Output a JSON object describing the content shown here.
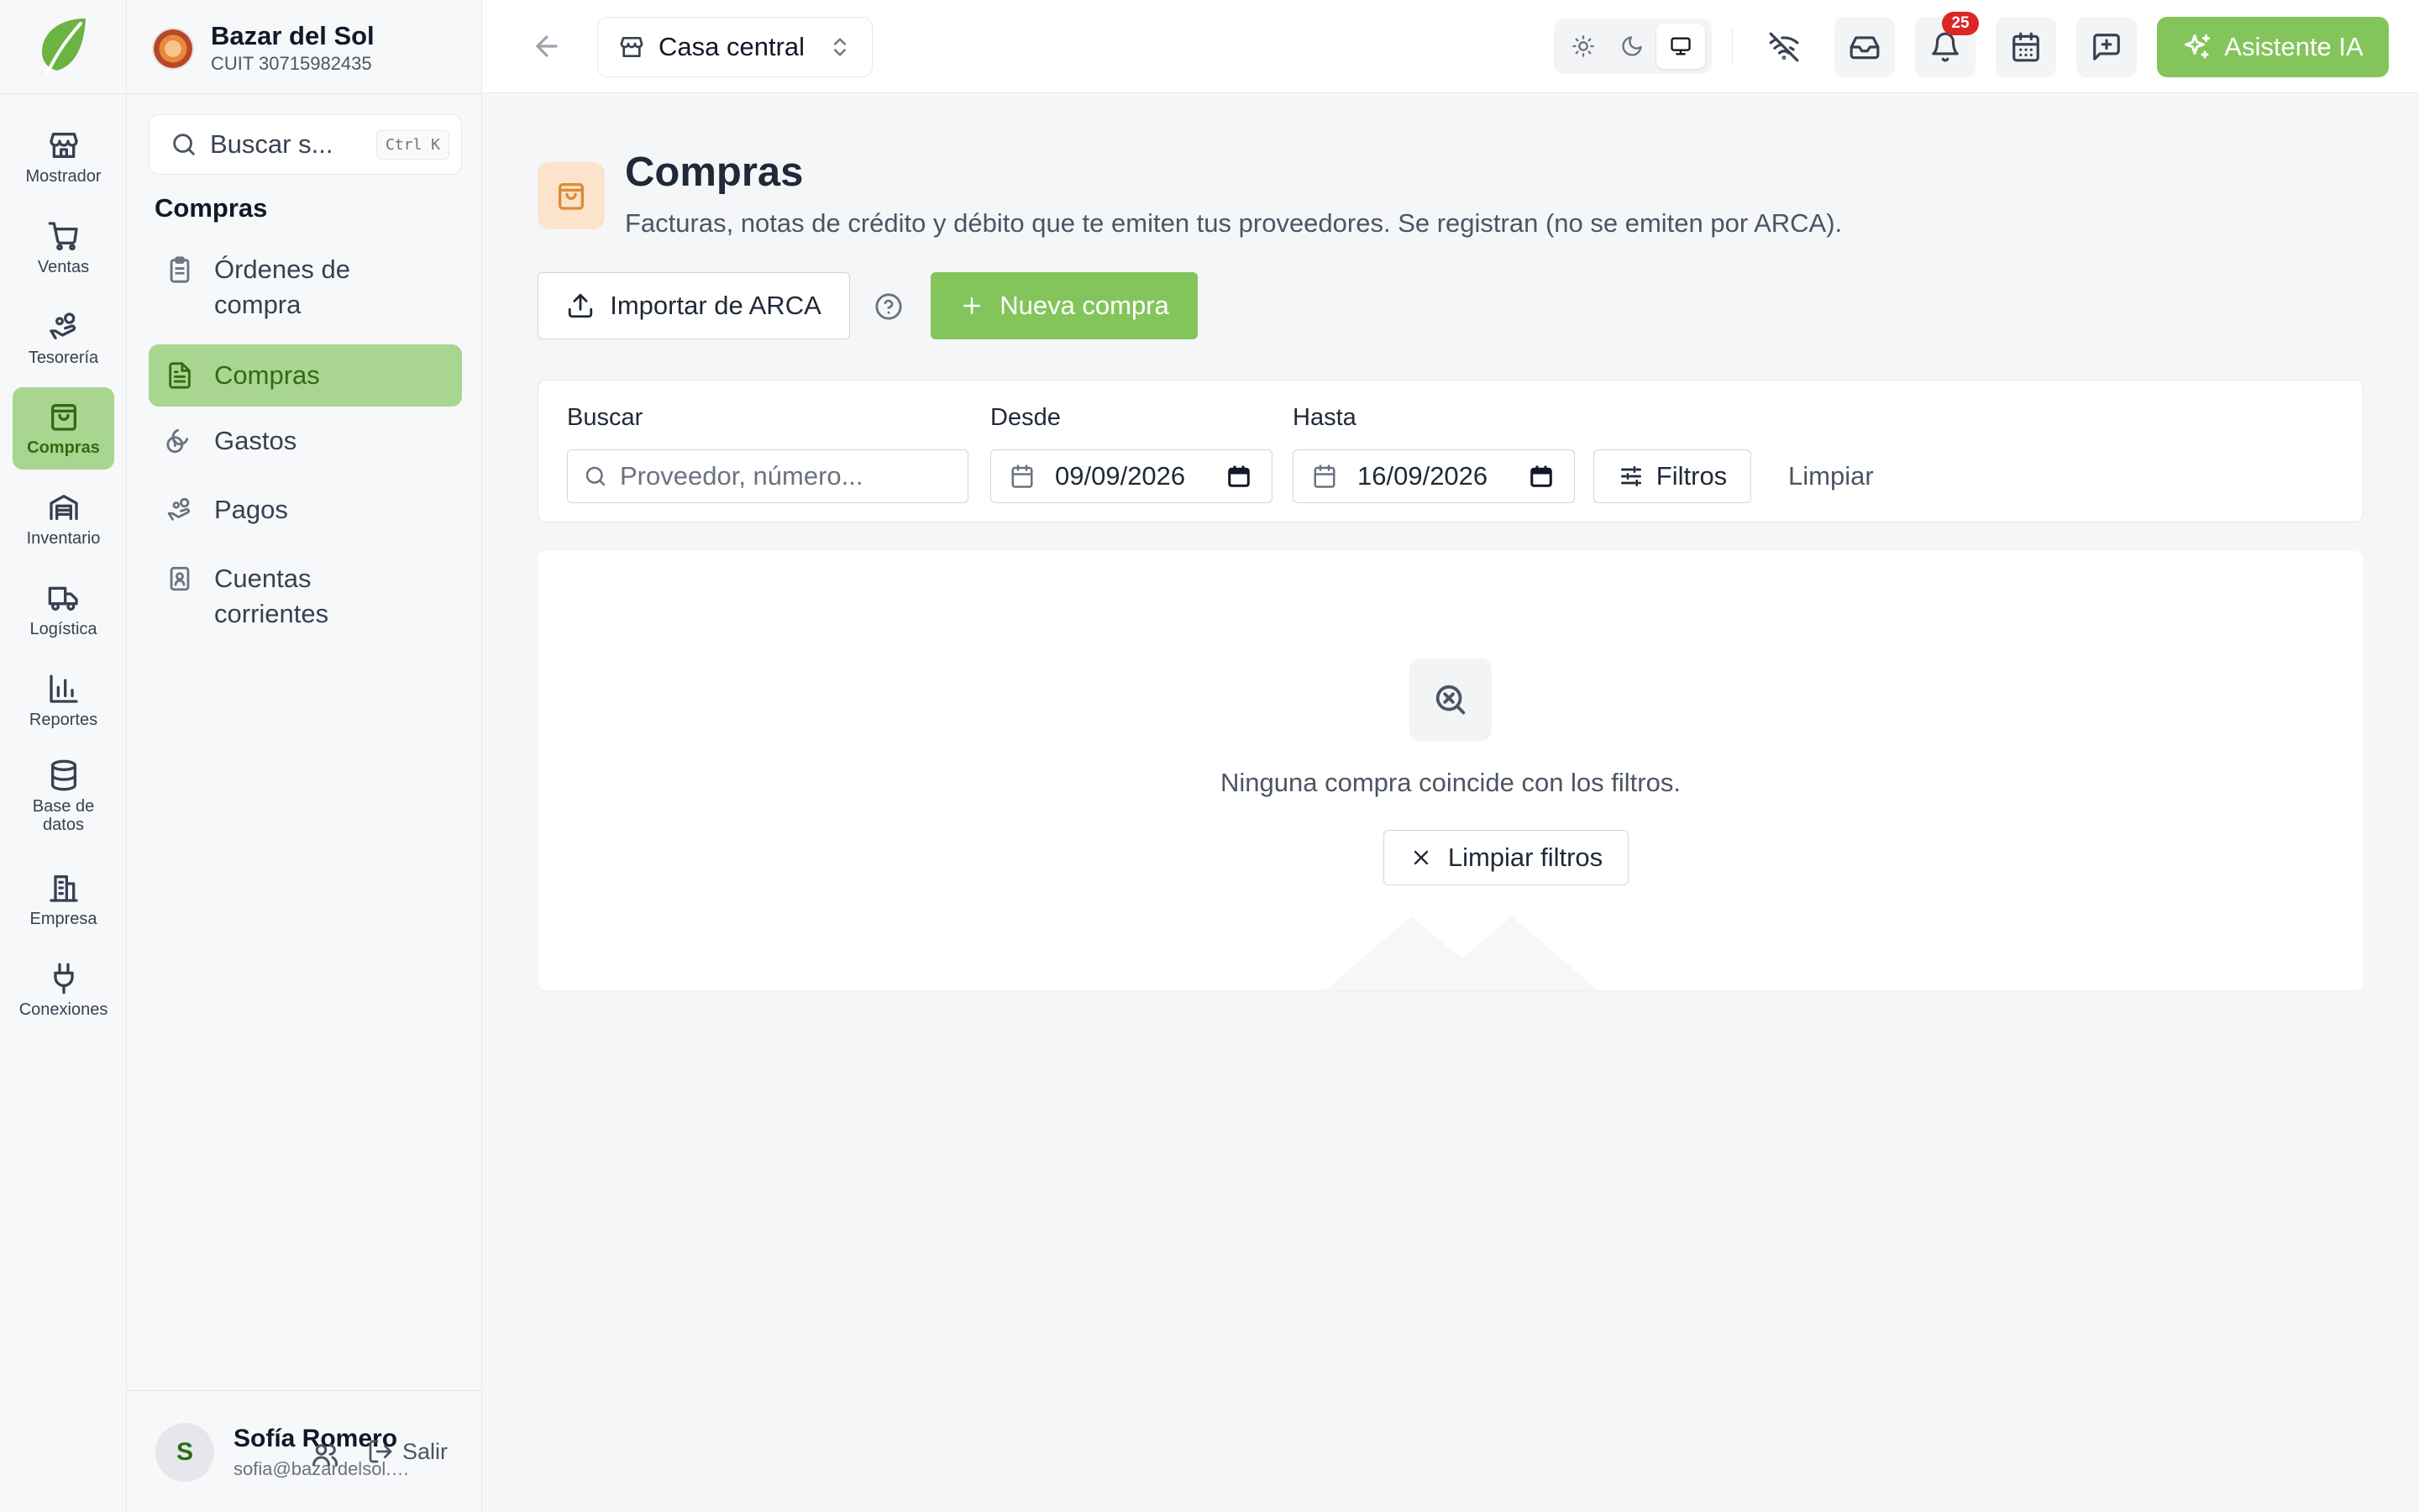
{
  "colors": {
    "accent": "#84c55b",
    "active_bg": "#a8d58f",
    "active_text": "#2f6b12",
    "badge": "#dc2626",
    "header_icon_bg": "#fbe3cc",
    "header_icon": "#e08a35"
  },
  "rail": {
    "items": [
      {
        "label": "Mostrador",
        "icon": "store-icon"
      },
      {
        "label": "Ventas",
        "icon": "cart-icon"
      },
      {
        "label": "Tesorería",
        "icon": "hand-coins-icon"
      },
      {
        "label": "Compras",
        "icon": "shopping-bag-icon",
        "active": true
      },
      {
        "label": "Inventario",
        "icon": "warehouse-icon"
      },
      {
        "label": "Logística",
        "icon": "truck-icon"
      },
      {
        "label": "Reportes",
        "icon": "bar-chart-icon"
      },
      {
        "label": "Base de datos",
        "icon": "database-icon"
      },
      {
        "label": "Empresa",
        "icon": "building-icon"
      },
      {
        "label": "Conexiones",
        "icon": "plug-icon"
      }
    ]
  },
  "org": {
    "name": "Bazar del Sol",
    "cuit": "CUIT 30715982435"
  },
  "sidebar": {
    "search_placeholder": "Buscar s...",
    "shortcut": "Ctrl K",
    "heading": "Compras",
    "items": [
      {
        "label": "Órdenes de compra",
        "icon": "clipboard-icon"
      },
      {
        "label": "Compras",
        "icon": "file-text-icon",
        "active": true
      },
      {
        "label": "Gastos",
        "icon": "coins-icon"
      },
      {
        "label": "Pagos",
        "icon": "hand-coins-icon"
      },
      {
        "label": "Cuentas corrientes",
        "icon": "contact-book-icon"
      }
    ]
  },
  "user": {
    "initial": "S",
    "name": "Sofía Romero",
    "email": "sofia@bazardelsol.com.ar",
    "logout_label": "Salir"
  },
  "topbar": {
    "branch": "Casa central",
    "notifications_count": "25",
    "ai_label": "Asistente IA",
    "theme_selected": "system"
  },
  "page": {
    "title": "Compras",
    "subtitle": "Facturas, notas de crédito y débito que te emiten tus proveedores. Se registran (no se emiten por ARCA).",
    "import_label": "Importar de ARCA",
    "new_label": "Nueva compra"
  },
  "filters": {
    "search_label": "Buscar",
    "search_placeholder": "Proveedor, número...",
    "from_label": "Desde",
    "from_value": "09/09/2026",
    "to_label": "Hasta",
    "to_value": "16/09/2026",
    "filters_label": "Filtros",
    "clear_label": "Limpiar"
  },
  "empty": {
    "message": "Ninguna compra coincide con los filtros.",
    "clear_filters_label": "Limpiar filtros"
  }
}
